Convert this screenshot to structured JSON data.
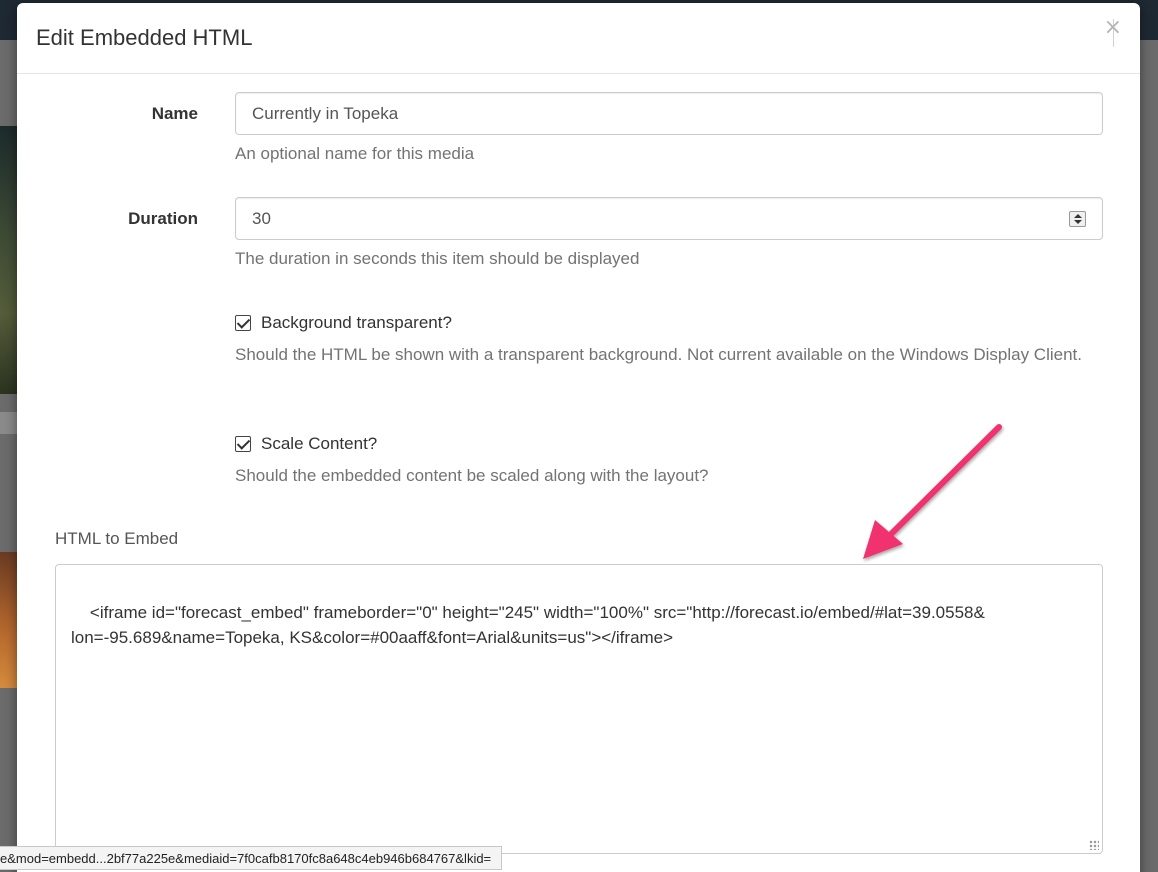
{
  "modal": {
    "title": "Edit Embedded HTML",
    "close_label": "×"
  },
  "form": {
    "name": {
      "label": "Name",
      "value": "Currently in Topeka",
      "help": "An optional name for this media"
    },
    "duration": {
      "label": "Duration",
      "value": "30",
      "help": "The duration in seconds this item should be displayed"
    },
    "transparent": {
      "label": "Background transparent?",
      "checked": true,
      "help": "Should the HTML be shown with a transparent background. Not current available on the Windows Display Client."
    },
    "scale": {
      "label": "Scale Content?",
      "checked": true,
      "help": "Should the embedded content be scaled along with the layout?"
    },
    "embed": {
      "label": "HTML to Embed",
      "value": "<iframe id=\"forecast_embed\" frameborder=\"0\" height=\"245\" width=\"100%\" src=\"http://forecast.io/embed/#lat=39.0558&\nlon=-95.689&name=Topeka, KS&color=#00aaff&font=Arial&units=us\"></iframe>"
    }
  },
  "statusbar": {
    "url": "e&mod=embedd...2bf77a225e&mediaid=7f0cafb8170fc8a648c4eb946b684767&lkid="
  },
  "colors": {
    "annotation_arrow": "#f0306e"
  }
}
